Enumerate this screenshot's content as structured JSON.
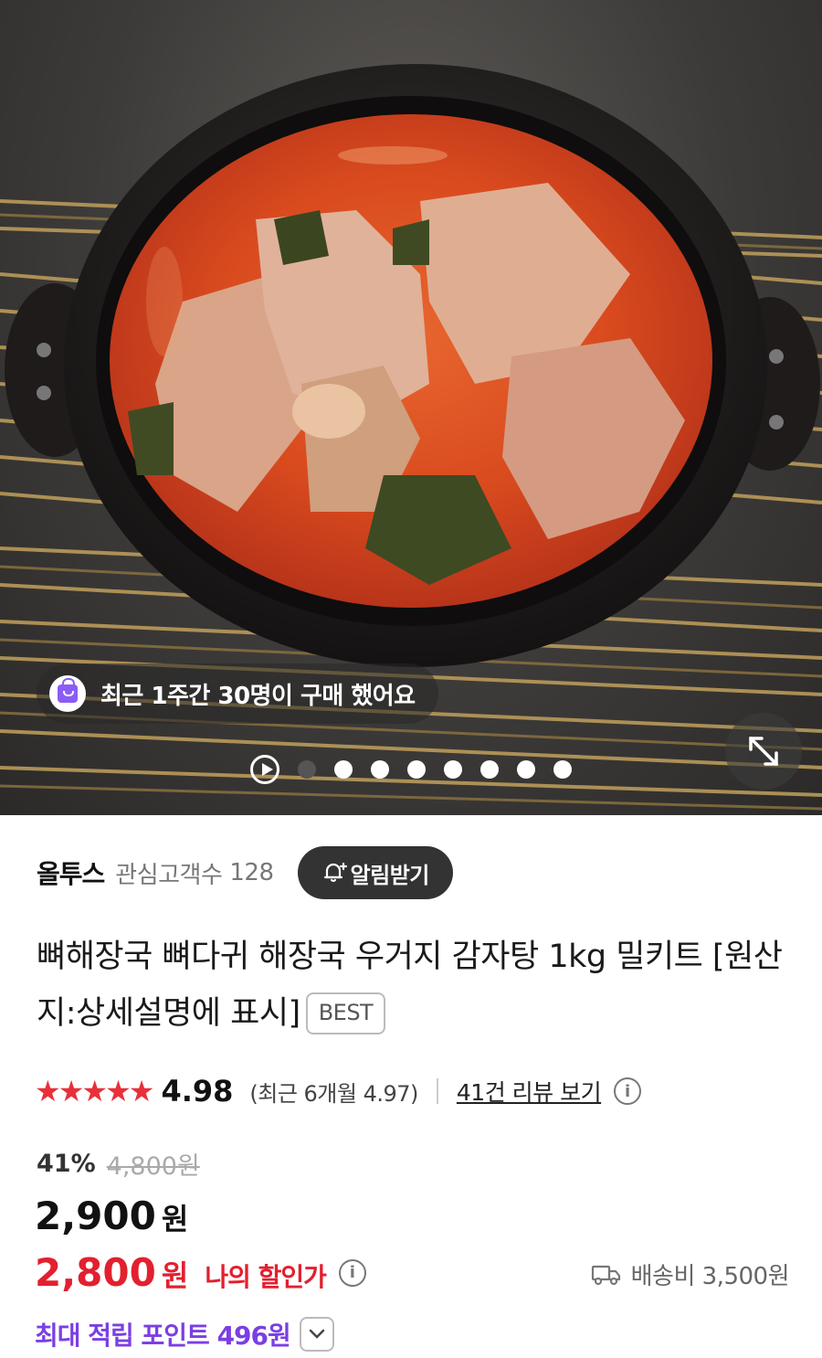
{
  "hero": {
    "purchase_badge": "최근 1주간 30명이 구매 했어요",
    "slide_count": 8,
    "active_slide": 1
  },
  "seller": {
    "name": "올투스",
    "followers_label": "관심고객수",
    "followers_count": "128",
    "notify_label": "알림받기"
  },
  "product": {
    "title": "뼈해장국 뼈다귀 해장국 우거지 감자탕 1kg 밀키트 [원산지:상세설명에 표시]",
    "badge": "BEST"
  },
  "rating": {
    "stars": "★★★★★",
    "score": "4.98",
    "recent": "(최근 6개월 4.97)",
    "review_link": "41건 리뷰 보기"
  },
  "pricing": {
    "discount_rate": "41%",
    "original_price": "4,800원",
    "price": "2,900",
    "price_unit": "원",
    "my_price": "2,800",
    "my_price_unit": "원",
    "my_price_label": "나의 할인가",
    "shipping": "배송비 3,500원",
    "points": "최대 적립 포인트 496원"
  },
  "colors": {
    "accent_red": "#e2202f",
    "points_purple": "#7b3fe4",
    "notify_bg": "#333333"
  }
}
